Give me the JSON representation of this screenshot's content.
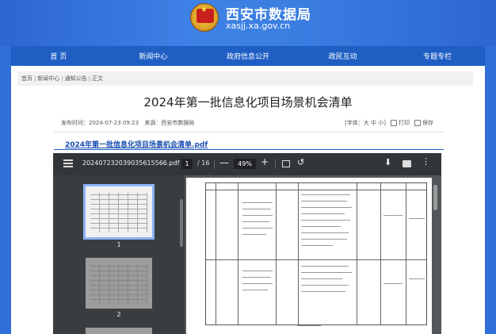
{
  "site": {
    "name": "西安市数据局",
    "url": "xasjj.xa.gov.cn"
  },
  "nav": [
    "首  页",
    "新闻中心",
    "政府信息公开",
    "政民互动",
    "专题专栏"
  ],
  "breadcrumb": [
    "首页",
    "新闻中心",
    "通知公告",
    "正文"
  ],
  "article": {
    "title": "2024年第一批信息化项目场景机会清单",
    "published": "发布时间：2024-07-23 09:23",
    "source": "来源：西安市数据局",
    "font_size": "[字体：大 中 小]",
    "print": "打印",
    "save": "保存"
  },
  "attachment": {
    "link_text": "2024年第一批信息化项目场景机会清单.pdf"
  },
  "pdf_viewer": {
    "file_name": "20240723203903561​5566.pdf",
    "current_page": "1",
    "total_pages": "/ 16",
    "zoom": "49%",
    "thumbnails": [
      {
        "label": "1"
      },
      {
        "label": "2"
      }
    ]
  }
}
